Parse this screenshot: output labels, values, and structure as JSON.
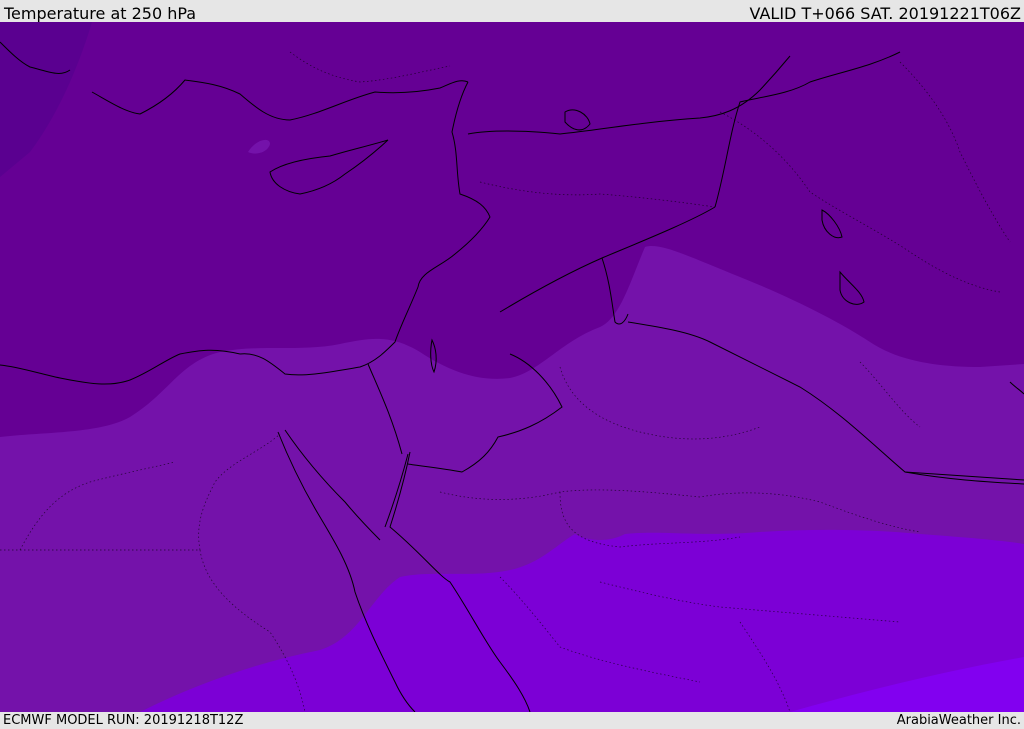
{
  "header": {
    "title": "Temperature at 250 hPa",
    "valid": "VALID T+066 SAT. 20191221T06Z"
  },
  "footer": {
    "model_run": "ECMWF MODEL RUN: 20191218T12Z",
    "credit": "ArabiaWeather Inc."
  },
  "map": {
    "variable": "temperature",
    "level": "250 hPa",
    "colors": {
      "band_darkest": "#5a0090",
      "band_dark": "#650094",
      "band_mid": "#7412aa",
      "band_light": "#7c00d6",
      "band_lightest": "#8200f0",
      "coastline": "#000000",
      "border": "#000000"
    }
  }
}
